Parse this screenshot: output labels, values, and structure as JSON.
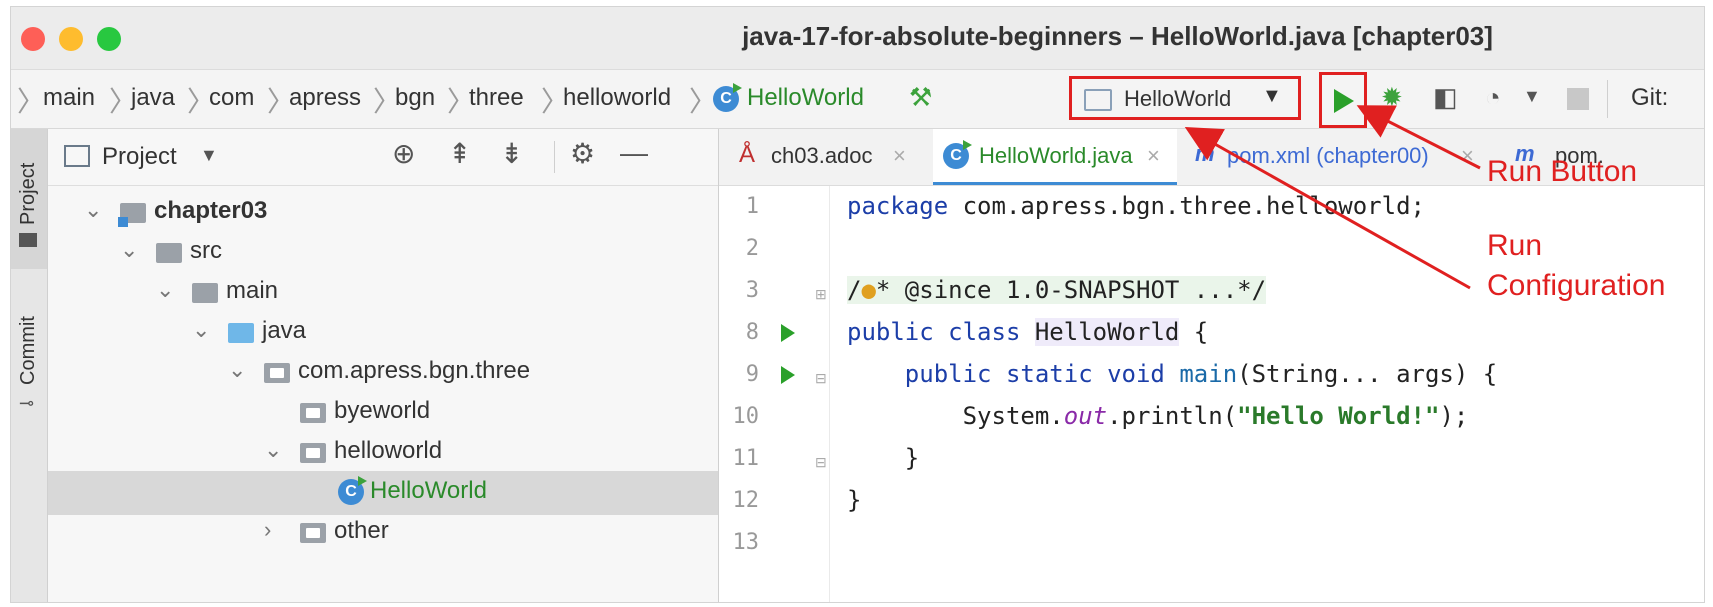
{
  "window": {
    "title": "java-17-for-absolute-beginners – HelloWorld.java [chapter03]",
    "traffic_lights": {
      "close_color": "#fe5f57",
      "minimize_color": "#febc2e",
      "zoom_color": "#28c840"
    }
  },
  "breadcrumb": {
    "items": [
      "main",
      "java",
      "com",
      "apress",
      "bgn",
      "three",
      "helloworld",
      "HelloWorld"
    ]
  },
  "toolbar": {
    "run_config": "HelloWorld",
    "git_label": "Git:"
  },
  "sidebar": {
    "project_tab": "Project",
    "commit_tab": "Commit"
  },
  "project_panel": {
    "title": "Project",
    "tree": [
      {
        "label": "chapter03",
        "bold": true
      },
      {
        "label": "src"
      },
      {
        "label": "main"
      },
      {
        "label": "java"
      },
      {
        "label": "com.apress.bgn.three"
      },
      {
        "label": "byeworld"
      },
      {
        "label": "helloworld"
      },
      {
        "label": "HelloWorld",
        "selected": true
      },
      {
        "label": "other"
      }
    ]
  },
  "editor": {
    "tabs": [
      {
        "label": "ch03.adoc",
        "close": "×"
      },
      {
        "label": "HelloWorld.java",
        "close": "×",
        "active": true
      },
      {
        "label": "pom.xml (chapter00)",
        "close": "×"
      },
      {
        "label": "pom."
      }
    ],
    "line_numbers": [
      "1",
      "2",
      "3",
      "8",
      "9",
      "10",
      "11",
      "12",
      "13"
    ],
    "code": {
      "l1_kw": "package",
      "l1_rest": " com.apress.bgn.three.helloworld;",
      "l3_a": "/",
      "l3_b": "* @since 1.0-SNAPSHOT ...*/",
      "l8_kw": "public class",
      "l8_name": "HelloWorld",
      "l8_rest": " {",
      "l9_indent": "    ",
      "l9_kw": "public static void",
      "l9_sp": " ",
      "l9_fn": "main",
      "l9_rest": "(String... args) {",
      "l10_indent": "        System.",
      "l10_out": "out",
      "l10_mid": ".println(",
      "l10_str": "\"Hello World!\"",
      "l10_end": ");",
      "l11": "    }",
      "l12": "}"
    }
  },
  "annotations": {
    "run_button": "Run Button",
    "run_configuration_line1": "Run",
    "run_configuration_line2": "Configuration",
    "color": "#e02020"
  }
}
